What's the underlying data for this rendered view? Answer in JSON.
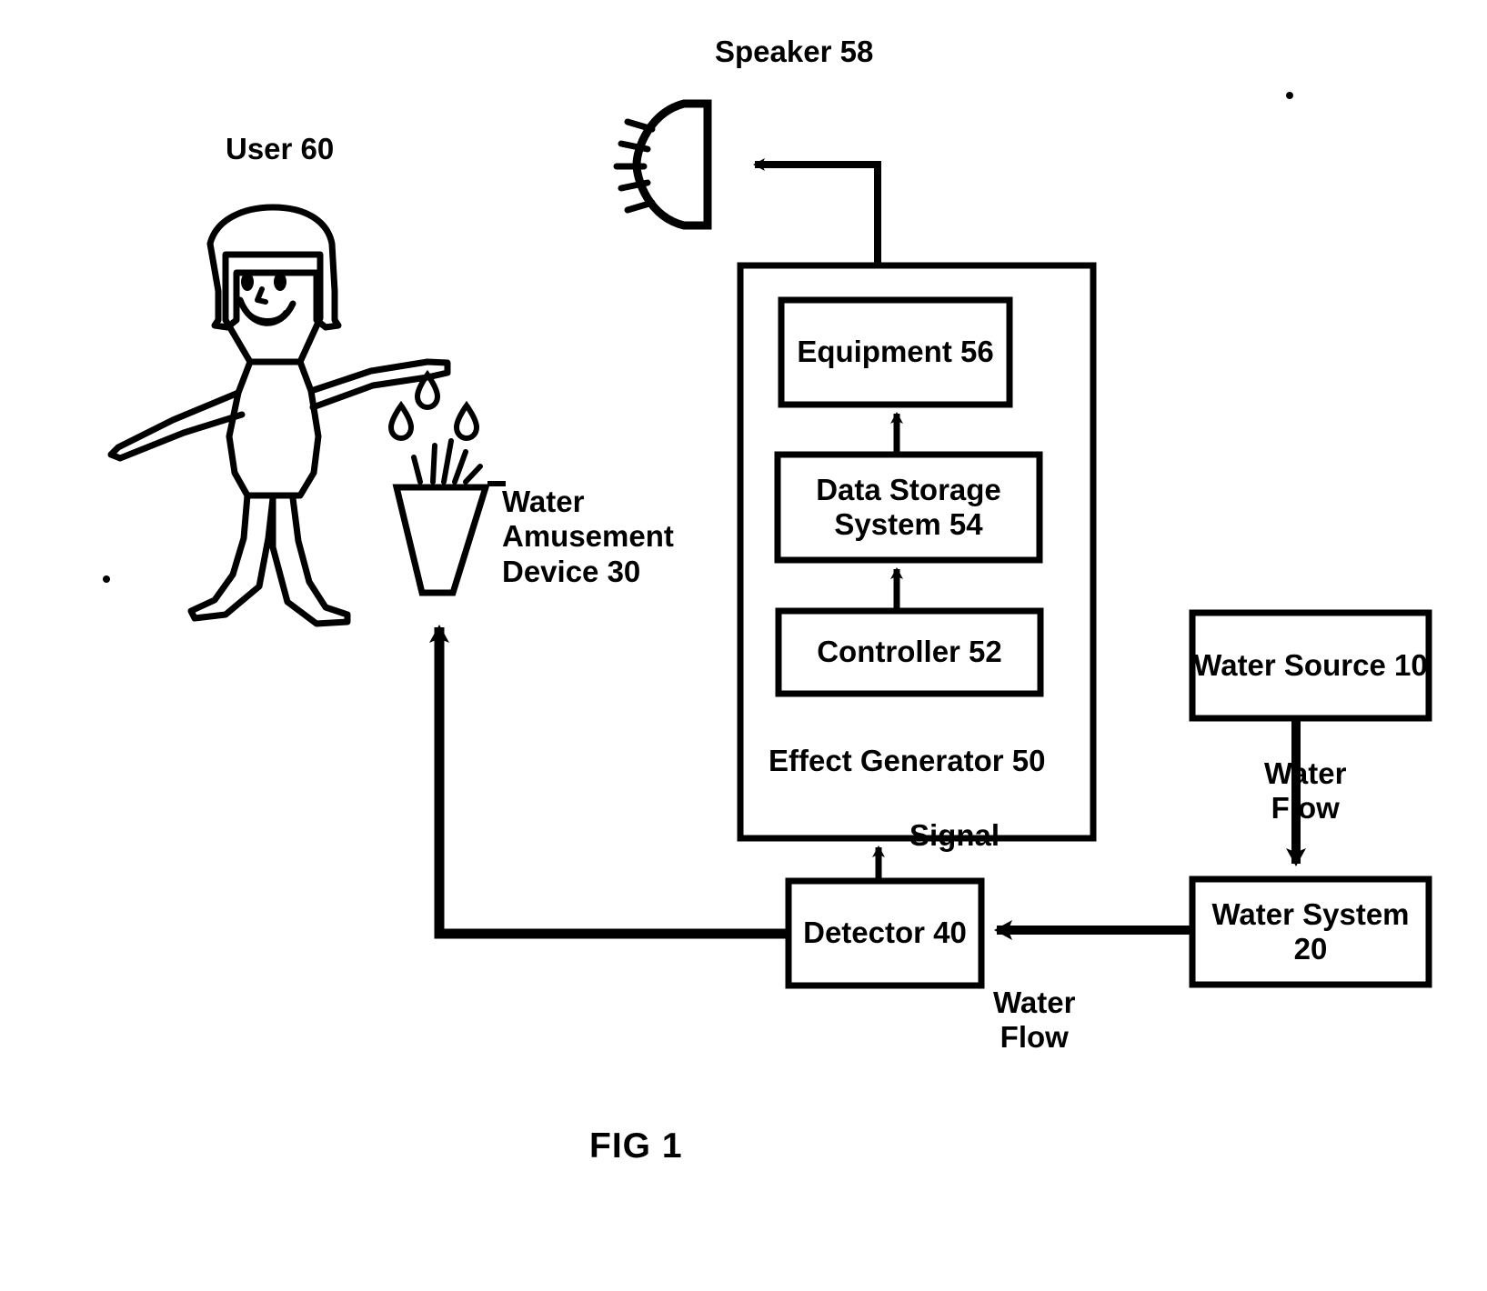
{
  "figure": {
    "caption": "FIG 1",
    "domain_type": "patent-block-diagram"
  },
  "labels": {
    "speaker": "Speaker 58",
    "user": "User 60",
    "water_amusement_device": "Water\nAmusement\nDevice 30",
    "effect_generator": "Effect Generator 50",
    "signal": "Signal",
    "water_flow_right": "Water\nFlow",
    "water_flow_bottom": "Water\nFlow"
  },
  "boxes": {
    "equipment": "Equipment\n56",
    "data_storage": "Data Storage\nSystem 54",
    "controller": "Controller 52",
    "detector": "Detector\n40",
    "water_source": "Water\nSource 10",
    "water_system": "Water\nSystem 20"
  },
  "icons": {
    "speaker": "speaker-icon",
    "user": "child-user-figure-icon",
    "device": "water-nozzle-icon",
    "droplets": "water-droplet-icon",
    "spray": "water-spray-lines-icon"
  },
  "colors": {
    "ink": "#000000",
    "paper": "#ffffff"
  },
  "connections": [
    {
      "from": "Effect Generator 50",
      "to": "Speaker 58",
      "label": ""
    },
    {
      "from": "Data Storage System 54",
      "to": "Equipment 56",
      "label": ""
    },
    {
      "from": "Controller 52",
      "to": "Data Storage System 54",
      "label": ""
    },
    {
      "from": "Detector 40",
      "to": "Effect Generator 50",
      "label": "Signal"
    },
    {
      "from": "Water System 20",
      "to": "Detector 40",
      "label": "Water Flow"
    },
    {
      "from": "Water Source 10",
      "to": "Water System 20",
      "label": "Water Flow"
    },
    {
      "from": "Detector 40",
      "to": "Water Amusement Device 30",
      "label": ""
    }
  ]
}
